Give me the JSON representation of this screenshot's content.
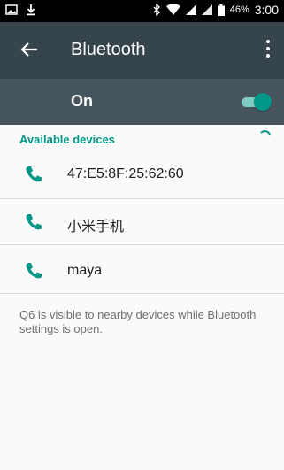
{
  "status_bar": {
    "battery_percent": "46%",
    "time": "3:00",
    "icons": [
      "image-icon",
      "download-icon",
      "bluetooth-icon",
      "wifi-icon",
      "signal-icon",
      "signal-icon-2",
      "battery-icon"
    ]
  },
  "toolbar": {
    "back_icon": "arrow-left-icon",
    "title": "Bluetooth",
    "menu_icon": "more-vertical-icon"
  },
  "master_switch": {
    "label": "On",
    "state": "on"
  },
  "available_devices": {
    "header": "Available devices",
    "items": [
      {
        "name": "47:E5:8F:25:62:60",
        "icon": "phone-icon"
      },
      {
        "name": "小米手机",
        "icon": "phone-icon"
      },
      {
        "name": "maya",
        "icon": "phone-icon"
      }
    ]
  },
  "footer_text": "Q6 is visible to nearby devices while Bluetooth settings is open.",
  "colors": {
    "toolbar": "#36444c",
    "switch_bar": "#45545d",
    "accent": "#009688"
  }
}
